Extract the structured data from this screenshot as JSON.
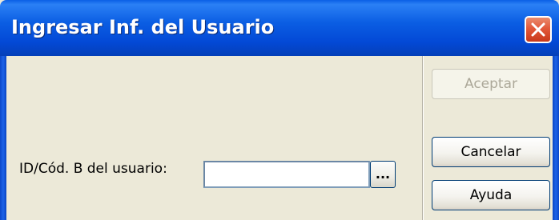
{
  "window": {
    "title": "Ingresar Inf. del Usuario",
    "close_icon": "close-icon"
  },
  "form": {
    "id_label": "ID/Cód. B del usuario:",
    "id_value": "",
    "browse_label": "..."
  },
  "buttons": {
    "accept_label": "Aceptar",
    "accept_enabled": false,
    "cancel_label": "Cancelar",
    "help_label": "Ayuda"
  },
  "colors": {
    "titlebar_blue": "#0349D6",
    "close_red": "#E2593A",
    "dialog_face": "#ECE9D8",
    "disabled_text": "#ACA899"
  }
}
